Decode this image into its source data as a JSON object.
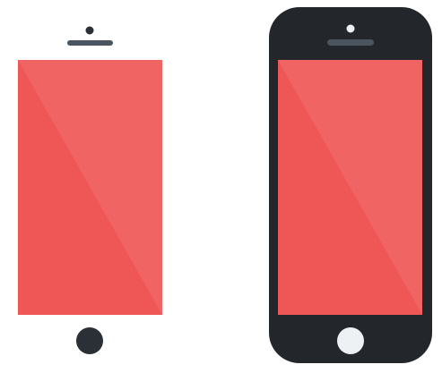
{
  "colors": {
    "background": "#ffffff",
    "screen_primary": "#ef5656",
    "screen_highlight": "#f06464",
    "phone_body": "#23272b",
    "hardware_dark": "#2b3036",
    "speaker_slate": "#4b5560",
    "home_button_light": "#eef1f4"
  },
  "illustrations": [
    {
      "name": "phone-without-body",
      "parts": [
        "camera-icon",
        "speaker-icon",
        "screen",
        "home-button"
      ]
    },
    {
      "name": "phone-with-body",
      "parts": [
        "phone-body",
        "camera-icon",
        "speaker-icon",
        "screen",
        "home-button"
      ]
    }
  ]
}
